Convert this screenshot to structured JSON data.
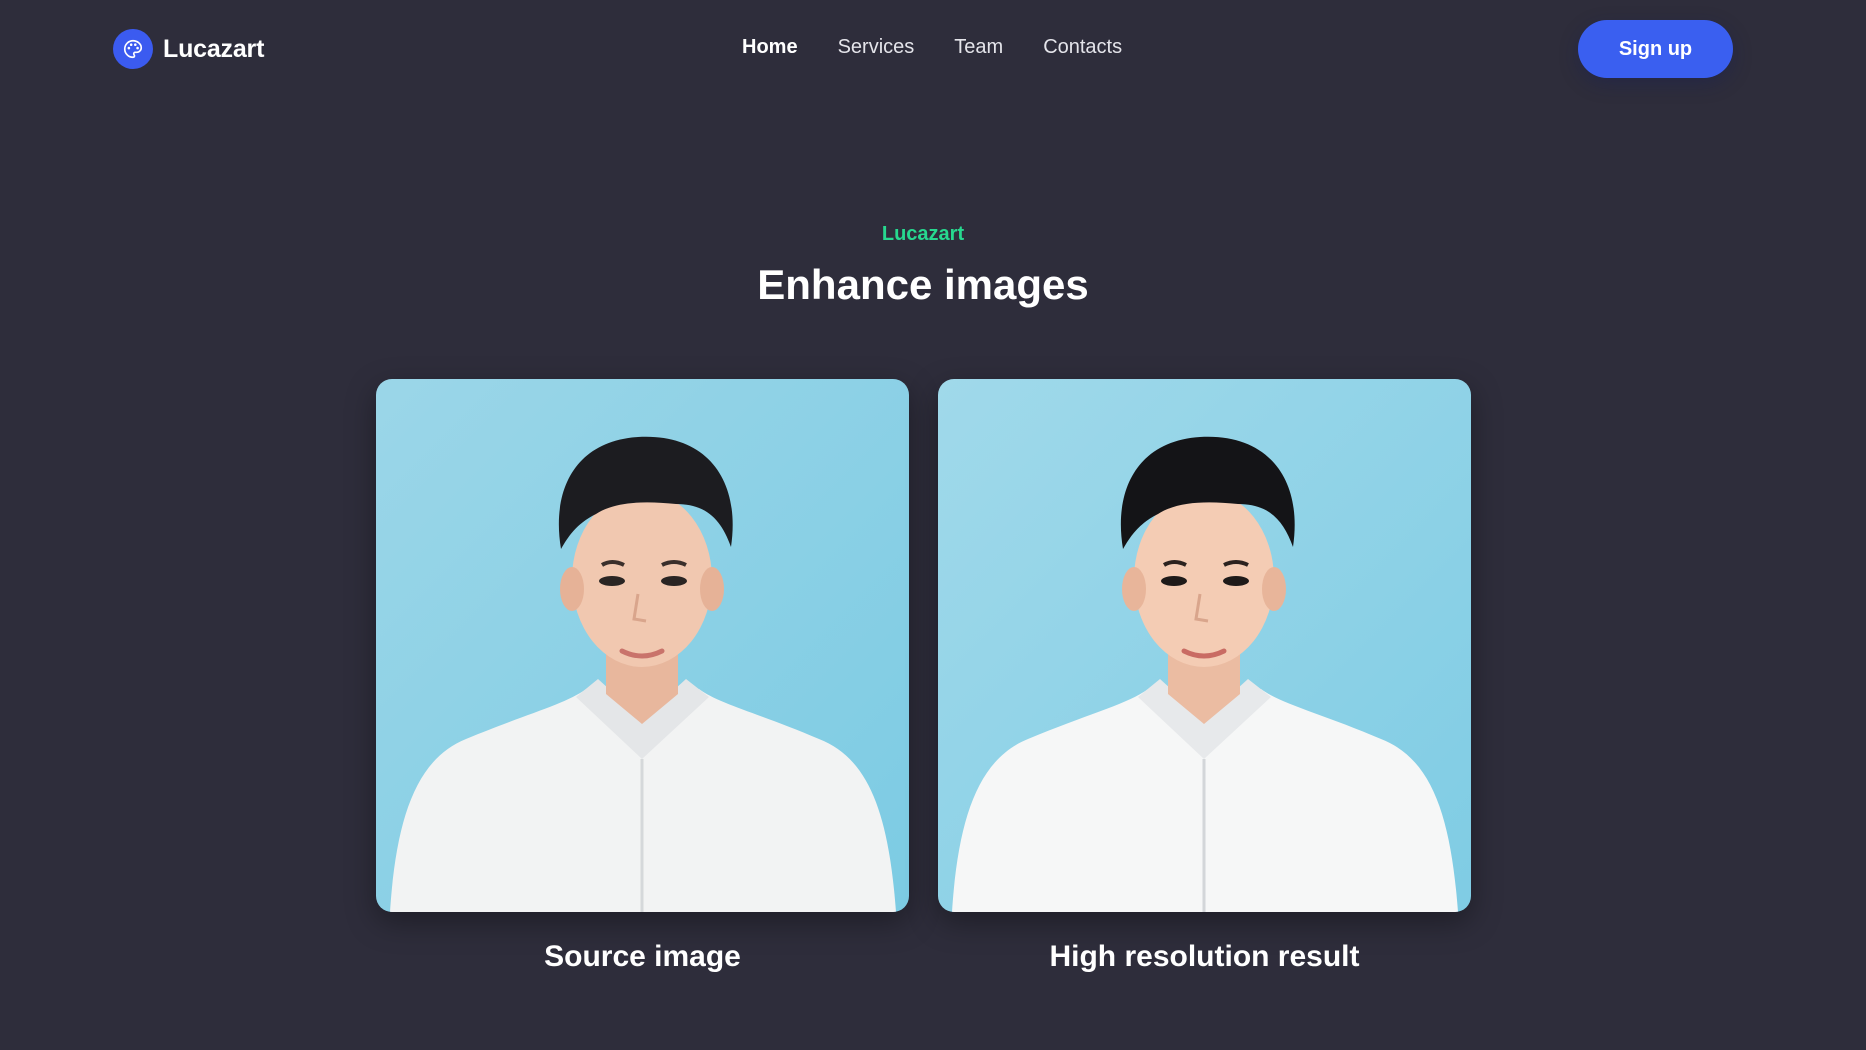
{
  "brand": {
    "name": "Lucazart",
    "logo_icon": "palette-icon",
    "logo_color": "#3b5bf0"
  },
  "nav": {
    "items": [
      {
        "label": "Home",
        "active": true
      },
      {
        "label": "Services",
        "active": false
      },
      {
        "label": "Team",
        "active": false
      },
      {
        "label": "Contacts",
        "active": false
      }
    ]
  },
  "signup": {
    "label": "Sign up",
    "color": "#3a5ff0"
  },
  "hero": {
    "eyebrow": "Lucazart",
    "eyebrow_color": "#27d88f",
    "title": "Enhance images"
  },
  "comparison": {
    "source_caption": "Source image",
    "result_caption": "High resolution result"
  },
  "colors": {
    "background": "#2e2d3b",
    "photo_background": "#8fd3e6"
  }
}
